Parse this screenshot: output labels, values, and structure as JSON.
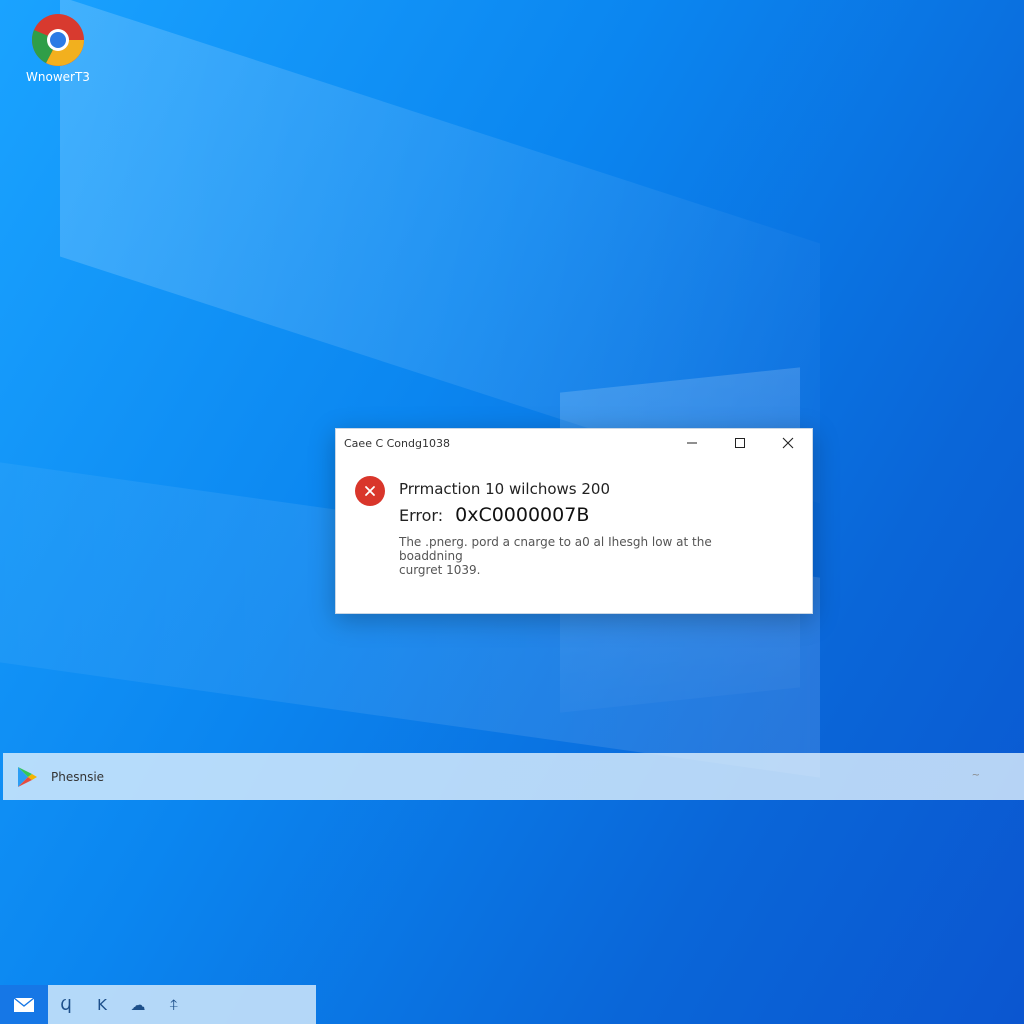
{
  "desktop": {
    "icon_label": "WnowerT3",
    "icon_name": "browser-logo-icon"
  },
  "dialog": {
    "title": "Caee C Condg1038",
    "controls": {
      "minimize": "minimize-icon",
      "maximize": "maximize-icon",
      "close": "close-icon"
    },
    "icon_name": "error-icon",
    "heading": "Prrmaction 10 wilchows 200",
    "error_label": "Error:",
    "error_code": "0xC0000007B",
    "body_line1": "The .pnerg. pord a cnarge to a0 al Ihesgh low at the boaddning",
    "body_line2": "curgret 1039.",
    "colors": {
      "error": "#d9362b"
    }
  },
  "app_bar": {
    "label": "Phesnsie",
    "icon_name": "play-icon",
    "mark": "~"
  },
  "taskbar": {
    "items": [
      {
        "name": "mail-icon"
      },
      {
        "name": "pin-icon",
        "glyph": "Ϥ"
      },
      {
        "name": "code-icon",
        "glyph": "K"
      },
      {
        "name": "chat-icon",
        "glyph": "☁"
      },
      {
        "name": "upload-icon",
        "glyph": "⍏"
      }
    ]
  },
  "colors": {
    "desktop_background": "#0b86f0",
    "accent": "#1677e6"
  }
}
